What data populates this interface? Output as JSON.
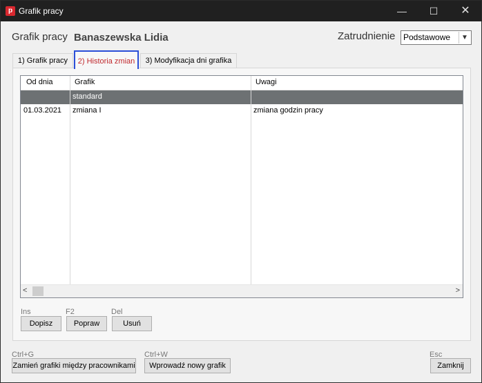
{
  "window": {
    "icon_letter": "p",
    "title": "Grafik pracy",
    "min_glyph": "—",
    "max_glyph": "☐",
    "close_glyph": "✕"
  },
  "header": {
    "label": "Grafik pracy",
    "employee_name": "Banaszewska Lidia",
    "employment_label": "Zatrudnienie",
    "employment_value": "Podstawowe"
  },
  "tabs": [
    {
      "label": "1) Grafik pracy"
    },
    {
      "label": "2) Historia zmian"
    },
    {
      "label": "3) Modyfikacja dni grafika"
    }
  ],
  "table": {
    "columns": [
      "Od dnia",
      "Grafik",
      "Uwagi"
    ],
    "rows": [
      {
        "date": "",
        "schedule": "standard",
        "notes": ""
      },
      {
        "date": "01.03.2021",
        "schedule": "zmiana I",
        "notes": "zmiana godzin pracy"
      }
    ],
    "scroll_left": "<",
    "scroll_right": ">"
  },
  "row_actions": [
    {
      "shortcut": "Ins",
      "label": "Dopisz"
    },
    {
      "shortcut": "F2",
      "label": "Popraw"
    },
    {
      "shortcut": "Del",
      "label": "Usuń"
    }
  ],
  "footer": {
    "swap": {
      "shortcut": "Ctrl+G",
      "label": "Zamień grafiki między pracownikami"
    },
    "new": {
      "shortcut": "Ctrl+W",
      "label": "Wprowadź nowy grafik"
    },
    "close": {
      "shortcut": "Esc",
      "label": "Zamknij"
    }
  },
  "colors": {
    "selected_row": "#6d7173",
    "active_tab_border": "#2a4ed8",
    "active_tab_text": "#c0282d",
    "titlebar": "#202020"
  }
}
